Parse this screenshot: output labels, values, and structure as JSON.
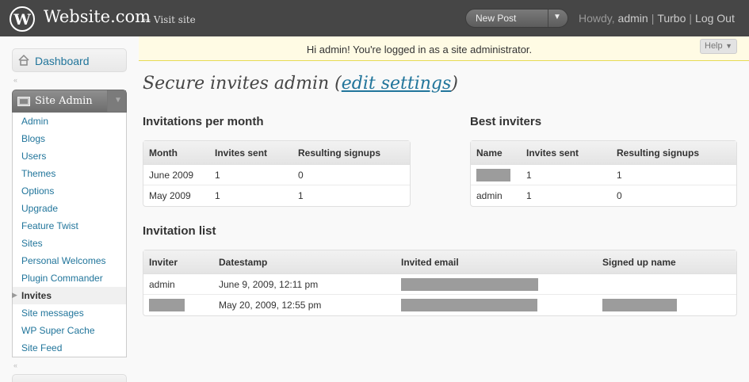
{
  "header": {
    "site_title": "Website.com",
    "visit_site": "← Visit site",
    "new_post": "New Post",
    "howdy": "Howdy, ",
    "user": "admin",
    "links": [
      "Turbo",
      "Log Out"
    ]
  },
  "notice": {
    "text": "Hi admin! You're logged in as a site administrator.",
    "help": "Help"
  },
  "sidebar": {
    "dashboard": "Dashboard",
    "site_admin": "Site Admin",
    "items": [
      "Admin",
      "Blogs",
      "Users",
      "Themes",
      "Options",
      "Upgrade",
      "Feature Twist",
      "Sites",
      "Personal Welcomes",
      "Plugin Commander",
      "Invites",
      "Site messages",
      "WP Super Cache",
      "Site Feed"
    ],
    "active_item": "Invites"
  },
  "page": {
    "title_prefix": "Secure invites admin (",
    "title_link": "edit settings",
    "title_suffix": ")"
  },
  "invitations_per_month": {
    "heading": "Invitations per month",
    "columns": [
      "Month",
      "Invites sent",
      "Resulting signups"
    ],
    "rows": [
      [
        "June 2009",
        "1",
        "0"
      ],
      [
        "May 2009",
        "1",
        "1"
      ]
    ]
  },
  "best_inviters": {
    "heading": "Best inviters",
    "columns": [
      "Name",
      "Invites sent",
      "Resulting signups"
    ],
    "rows": [
      [
        "",
        "1",
        "1"
      ],
      [
        "admin",
        "1",
        "0"
      ]
    ]
  },
  "invitation_list": {
    "heading": "Invitation list",
    "columns": [
      "Inviter",
      "Datestamp",
      "Invited email",
      "Signed up name"
    ],
    "rows": [
      [
        "admin",
        "June 9, 2009, 12:11 pm",
        "",
        ""
      ],
      [
        "",
        "May 20, 2009, 12:55 pm",
        "",
        ""
      ]
    ]
  },
  "colors": {
    "header_bg": "#464646",
    "link": "#21759b",
    "notice_bg": "#fffbe4",
    "redaction": "#9c9c9c"
  }
}
